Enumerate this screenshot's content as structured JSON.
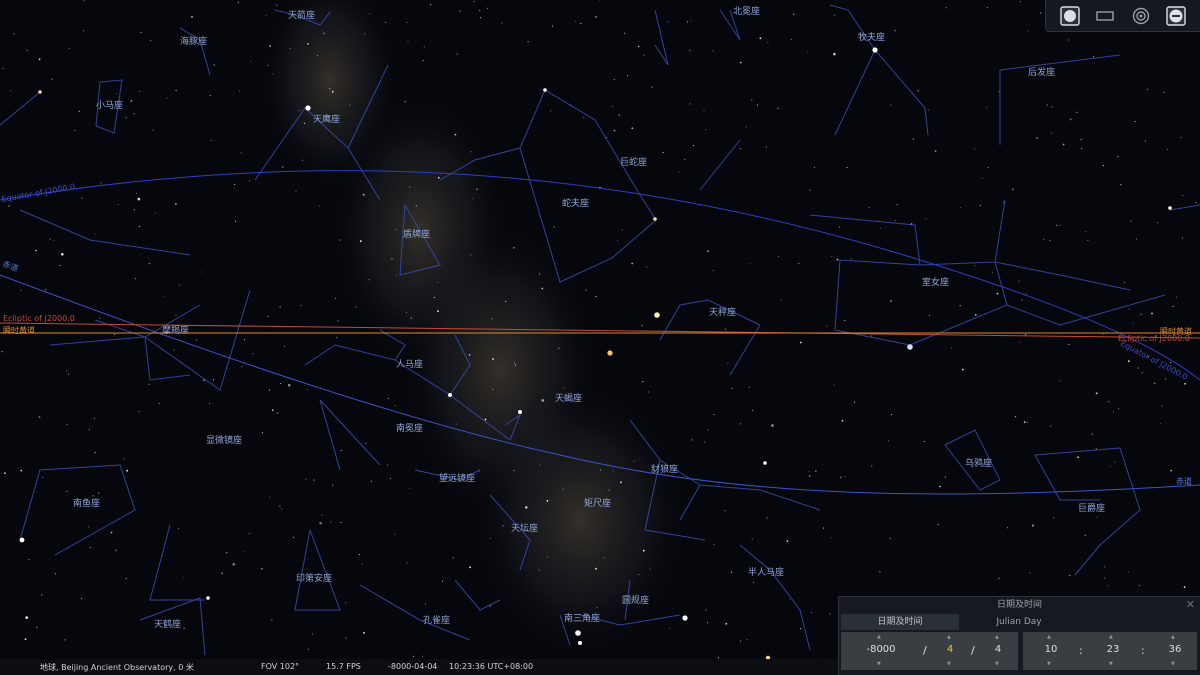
{
  "colors": {
    "background": "#05070c",
    "constellation_line": "#3a4db0",
    "constellation_label": "#8fa6d8",
    "equator_line": "#2d3fc2",
    "ecliptic_j2000": "#c24a3a",
    "ecliptic_of_date": "#d98a32",
    "panel": "#16191f",
    "highlight_value": "#f0c030"
  },
  "constellations": [
    "天箭座",
    "海豚座",
    "小马座",
    "天鹰座",
    "盾牌座",
    "蛇夫座",
    "巨蛇座",
    "北冕座",
    "牧夫座",
    "后发座",
    "室女座",
    "天秤座",
    "摩羯座",
    "人马座",
    "天蝎座",
    "显微镜座",
    "南冕座",
    "望远镜座",
    "豺狼座",
    "乌鸦座",
    "南鱼座",
    "天坛座",
    "矩尺座",
    "巨爵座",
    "半人马座",
    "印第安座",
    "圆规座",
    "天鹤座",
    "孔雀座",
    "南三角座"
  ],
  "sky_lines": {
    "equator_left_label": "Equator of J2000.0",
    "equator_right_label": "Equator of J2000.0",
    "equator_of_date_left": "赤道",
    "equator_of_date_right": "赤道",
    "ecliptic_j2000_left": "Ecliptic of J2000.0",
    "ecliptic_j2000_right": "Ecliptic of J2000.0",
    "ecliptic_of_date_left": "瞬时黄道",
    "ecliptic_of_date_right": "瞬时黄道"
  },
  "topbar": {
    "icons": [
      "full-disk-icon",
      "rectangle-icon",
      "target-circle-icon",
      "minus-circle-icon"
    ]
  },
  "status": {
    "location": "地球, Beijing Ancient Observatory, 0 米",
    "fov": "FOV 102°",
    "fps": "15.7 FPS",
    "date": "-8000-04-04",
    "time": "10:23:36 UTC+08:00"
  },
  "datetime_panel": {
    "title": "日期及时间",
    "tab_datetime": "日期及时间",
    "tab_julian": "Julian Day",
    "year": "-8000",
    "sep1": "/",
    "month": "4",
    "sep2": "/",
    "day": "4",
    "hour": "10",
    "sep3": ":",
    "minute": "23",
    "sep4": ":",
    "second": "36"
  }
}
